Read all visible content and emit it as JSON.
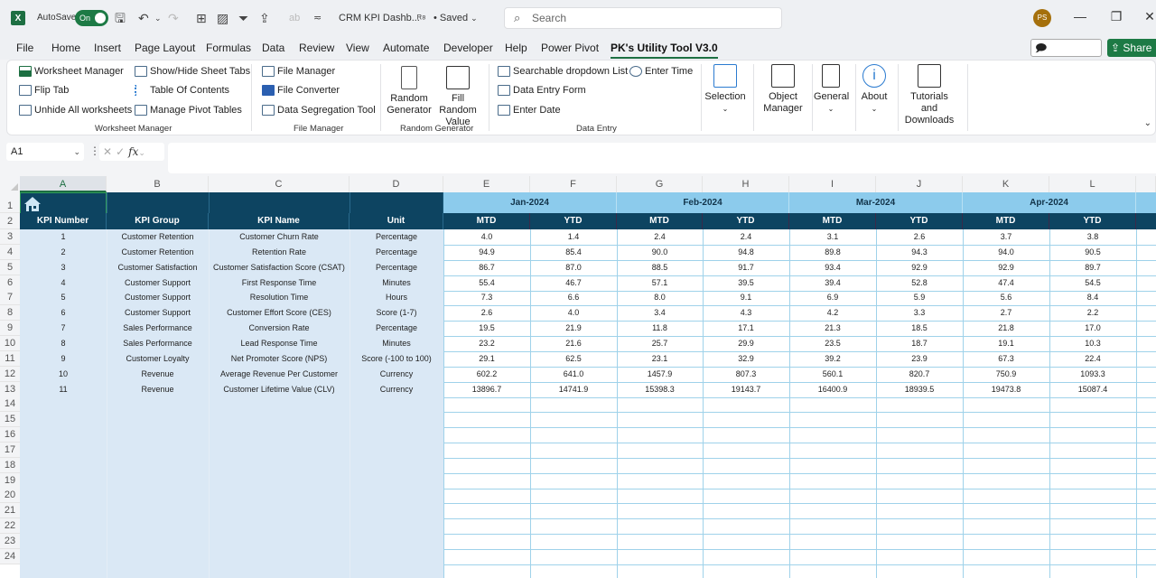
{
  "titlebar": {
    "app_icon": "X",
    "autosave_label": "AutoSave",
    "autosave_state": "On",
    "doc_title": "CRM KPI Dashb...",
    "saved_status": "• Saved",
    "search_placeholder": "Search",
    "avatar_initials": "PS",
    "minimize": "—",
    "restore": "❐",
    "close": "✕"
  },
  "menu": {
    "items": [
      "File",
      "Home",
      "Insert",
      "Page Layout",
      "Formulas",
      "Data",
      "Review",
      "View",
      "Automate",
      "Developer",
      "Help",
      "Power Pivot",
      "PK's Utility Tool V3.0"
    ],
    "active_index": 12,
    "comments_label": "Comments",
    "share_label": "Share"
  },
  "ribbon": {
    "worksheet_manager": {
      "label": "Worksheet Manager",
      "buttons": [
        "Worksheet Manager",
        "Flip Tab",
        "Unhide All worksheets",
        "Show/Hide Sheet Tabs",
        "Table Of Contents",
        "Manage Pivot Tables"
      ]
    },
    "file_manager": {
      "label": "File Manager",
      "buttons": [
        "File Manager",
        "File Converter",
        "Data Segregation Tool"
      ]
    },
    "random_generator": {
      "label": "Random Generator",
      "buttons": [
        "Random Generator",
        "Fill Random Value"
      ]
    },
    "data_entry": {
      "label": "Data Entry",
      "buttons": [
        "Searchable dropdown List",
        "Data Entry Form",
        "Enter Date",
        "Enter Time"
      ]
    },
    "large_buttons": [
      "Selection",
      "Object Manager",
      "General",
      "About",
      "Tutorials and Downloads"
    ]
  },
  "formula_bar": {
    "name_box": "A1",
    "formula": ""
  },
  "sheet": {
    "columns": [
      "A",
      "B",
      "C",
      "D",
      "E",
      "F",
      "G",
      "H",
      "I",
      "J",
      "K",
      "L"
    ],
    "selected_column": "A",
    "row_numbers": [
      "1",
      "2",
      "3",
      "4",
      "5",
      "6",
      "7",
      "8",
      "9",
      "10",
      "11",
      "12",
      "13",
      "14",
      "15",
      "16",
      "17",
      "18",
      "19",
      "20",
      "21",
      "22",
      "23",
      "24"
    ],
    "headers": [
      "KPI Number",
      "KPI Group",
      "KPI Name",
      "Unit"
    ],
    "months": [
      "Jan-2024",
      "Feb-2024",
      "Mar-2024",
      "Apr-2024"
    ],
    "sub_headers": [
      "MTD",
      "YTD"
    ],
    "rows": [
      {
        "num": "1",
        "group": "Customer Retention",
        "name": "Customer Churn Rate",
        "unit": "Percentage",
        "values": [
          "4.0",
          "1.4",
          "2.4",
          "2.4",
          "3.1",
          "2.6",
          "3.7",
          "3.8"
        ]
      },
      {
        "num": "2",
        "group": "Customer Retention",
        "name": "Retention Rate",
        "unit": "Percentage",
        "values": [
          "94.9",
          "85.4",
          "90.0",
          "94.8",
          "89.8",
          "94.3",
          "94.0",
          "90.5"
        ]
      },
      {
        "num": "3",
        "group": "Customer Satisfaction",
        "name": "Customer Satisfaction Score (CSAT)",
        "unit": "Percentage",
        "values": [
          "86.7",
          "87.0",
          "88.5",
          "91.7",
          "93.4",
          "92.9",
          "92.9",
          "89.7"
        ]
      },
      {
        "num": "4",
        "group": "Customer Support",
        "name": "First Response Time",
        "unit": "Minutes",
        "values": [
          "55.4",
          "46.7",
          "57.1",
          "39.5",
          "39.4",
          "52.8",
          "47.4",
          "54.5"
        ]
      },
      {
        "num": "5",
        "group": "Customer Support",
        "name": "Resolution Time",
        "unit": "Hours",
        "values": [
          "7.3",
          "6.6",
          "8.0",
          "9.1",
          "6.9",
          "5.9",
          "5.6",
          "8.4"
        ]
      },
      {
        "num": "6",
        "group": "Customer Support",
        "name": "Customer Effort Score (CES)",
        "unit": "Score (1-7)",
        "values": [
          "2.6",
          "4.0",
          "3.4",
          "4.3",
          "4.2",
          "3.3",
          "2.7",
          "2.2"
        ]
      },
      {
        "num": "7",
        "group": "Sales Performance",
        "name": "Conversion Rate",
        "unit": "Percentage",
        "values": [
          "19.5",
          "21.9",
          "11.8",
          "17.1",
          "21.3",
          "18.5",
          "21.8",
          "17.0"
        ]
      },
      {
        "num": "8",
        "group": "Sales Performance",
        "name": "Lead Response Time",
        "unit": "Minutes",
        "values": [
          "23.2",
          "21.6",
          "25.7",
          "29.9",
          "23.5",
          "18.7",
          "19.1",
          "10.3"
        ]
      },
      {
        "num": "9",
        "group": "Customer Loyalty",
        "name": "Net Promoter Score (NPS)",
        "unit": "Score (-100 to 100)",
        "values": [
          "29.1",
          "62.5",
          "23.1",
          "32.9",
          "39.2",
          "23.9",
          "67.3",
          "22.4"
        ]
      },
      {
        "num": "10",
        "group": "Revenue",
        "name": "Average Revenue Per Customer",
        "unit": "Currency",
        "values": [
          "602.2",
          "641.0",
          "1457.9",
          "807.3",
          "560.1",
          "820.7",
          "750.9",
          "1093.3"
        ]
      },
      {
        "num": "11",
        "group": "Revenue",
        "name": "Customer Lifetime Value (CLV)",
        "unit": "Currency",
        "values": [
          "13896.7",
          "14741.9",
          "15398.3",
          "19143.7",
          "16400.9",
          "18939.5",
          "19473.8",
          "15087.4"
        ]
      }
    ]
  },
  "colors": {
    "header_dark": "#0d4461",
    "header_month": "#8ccbec",
    "left_fill": "#dae8f5",
    "grid_line": "#9fd2ea",
    "excel_green": "#1d6f42"
  }
}
